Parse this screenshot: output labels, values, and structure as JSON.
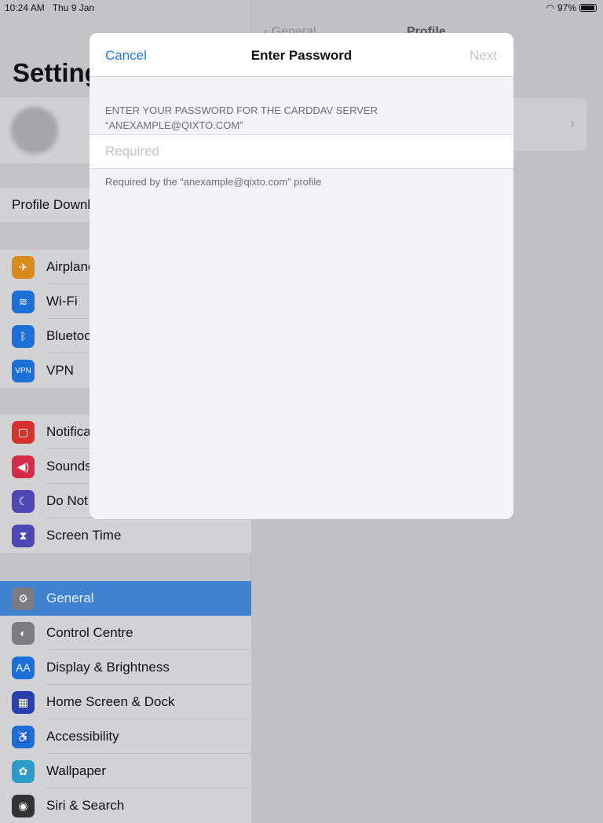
{
  "status": {
    "time": "10:24 AM",
    "date": "Thu 9 Jan",
    "battery": "97%",
    "battery_level": 0.97
  },
  "sidebar": {
    "title": "Settings",
    "profile_downloaded": "Profile Downloaded",
    "groups": [
      [
        {
          "label": "Airplane Mode",
          "icon": "airplane-icon",
          "color": "#d98a1c",
          "glyph": "✈"
        },
        {
          "label": "Wi-Fi",
          "icon": "wifi-icon",
          "color": "#1b6fd6",
          "glyph": "≋"
        },
        {
          "label": "Bluetooth",
          "icon": "bluetooth-icon",
          "color": "#1b6fd6",
          "glyph": "ᛒ"
        },
        {
          "label": "VPN",
          "icon": "vpn-icon",
          "color": "#1b6fd6",
          "glyph": "VPN"
        }
      ],
      [
        {
          "label": "Notifications",
          "icon": "notifications-icon",
          "color": "#d6312c",
          "glyph": "▢"
        },
        {
          "label": "Sounds",
          "icon": "sounds-icon",
          "color": "#d42b4a",
          "glyph": "◀)"
        },
        {
          "label": "Do Not Disturb",
          "icon": "moon-icon",
          "color": "#4f47b3",
          "glyph": "☾"
        },
        {
          "label": "Screen Time",
          "icon": "hourglass-icon",
          "color": "#4f47b3",
          "glyph": "⧗"
        }
      ],
      [
        {
          "label": "General",
          "icon": "gear-icon",
          "color": "#7b7b80",
          "glyph": "⚙",
          "selected": true
        },
        {
          "label": "Control Centre",
          "icon": "toggles-icon",
          "color": "#7b7b80",
          "glyph": "◐"
        },
        {
          "label": "Display & Brightness",
          "icon": "display-icon",
          "color": "#1b6fd6",
          "glyph": "AA"
        },
        {
          "label": "Home Screen & Dock",
          "icon": "home-screen-icon",
          "color": "#2a3fb0",
          "glyph": "▦"
        },
        {
          "label": "Accessibility",
          "icon": "accessibility-icon",
          "color": "#1b6fd6",
          "glyph": "♿"
        },
        {
          "label": "Wallpaper",
          "icon": "wallpaper-icon",
          "color": "#2b9bc7",
          "glyph": "✿"
        },
        {
          "label": "Siri & Search",
          "icon": "siri-icon",
          "color": "#333",
          "glyph": "◉"
        }
      ]
    ]
  },
  "detail": {
    "back": "General",
    "title": "Profile"
  },
  "modal": {
    "cancel": "Cancel",
    "title": "Enter Password",
    "next": "Next",
    "section_header_line1": "ENTER YOUR PASSWORD FOR THE CARDDAV SERVER",
    "section_header_line2": "“ANEXAMPLE@QIXTO.COM”",
    "password_placeholder": "Required",
    "password_value": "",
    "footer": "Required by the “anexample@qixto.com” profile"
  }
}
